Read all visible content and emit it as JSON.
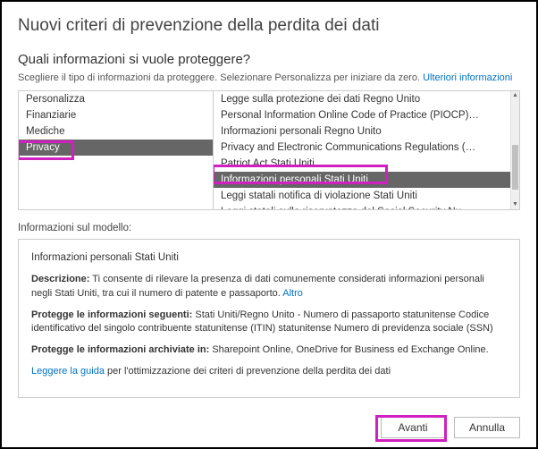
{
  "title": "Nuovi criteri di prevenzione della perdita dei dati",
  "subtitle": "Quali informazioni si vuole proteggere?",
  "desc_text": "Scegliere il tipo di informazioni da proteggere. Selezionare Personalizza per iniziare da zero. ",
  "desc_link": "Ulteriori informazioni",
  "categories": {
    "items": [
      {
        "label": "Personalizza"
      },
      {
        "label": "Finanziarie"
      },
      {
        "label": "Mediche"
      },
      {
        "label": "Privacy"
      }
    ],
    "selected_index": 3
  },
  "templates": {
    "items": [
      {
        "label": "Legge sulla protezione dei dati Regno Unito"
      },
      {
        "label": "Personal Information Online Code of Practice (PIOCP)…"
      },
      {
        "label": "Informazioni personali Regno Unito"
      },
      {
        "label": "Privacy and Electronic Communications Regulations (…"
      },
      {
        "label": "Patriot Act Stati Uniti"
      },
      {
        "label": "Informazioni personali Stati Uniti"
      },
      {
        "label": "Leggi statali notifica di violazione Stati Uniti"
      },
      {
        "label": "Leggi statali sulla riservatezza del Social Security Nu…"
      }
    ],
    "selected_index": 5
  },
  "info_label": "Informazioni sul modello:",
  "info": {
    "heading": "Informazioni personali Stati Uniti",
    "desc_label": "Descrizione:",
    "desc_text": " Ti consente di rilevare la presenza di dati comunemente considerati informazioni personali negli Stati Uniti, tra cui il numero di patente e passaporto. ",
    "desc_more": "Altro",
    "protects_label": "Protegge le informazioni seguenti:",
    "protects_text": " Stati Uniti/Regno Unito -  Numero di passaporto statunitense Codice identificativo del singolo contribuente statunitense (ITIN) statunitense Numero di previdenza sociale (SSN)",
    "archived_label": "Protegge le informazioni archiviate in:",
    "archived_text": " Sharepoint Online, OneDrive for Business ed Exchange Online.",
    "guide_link": "Leggere la guida",
    "guide_text": " per l'ottimizzazione dei criteri di prevenzione della perdita dei dati"
  },
  "buttons": {
    "next": "Avanti",
    "cancel": "Annulla"
  }
}
